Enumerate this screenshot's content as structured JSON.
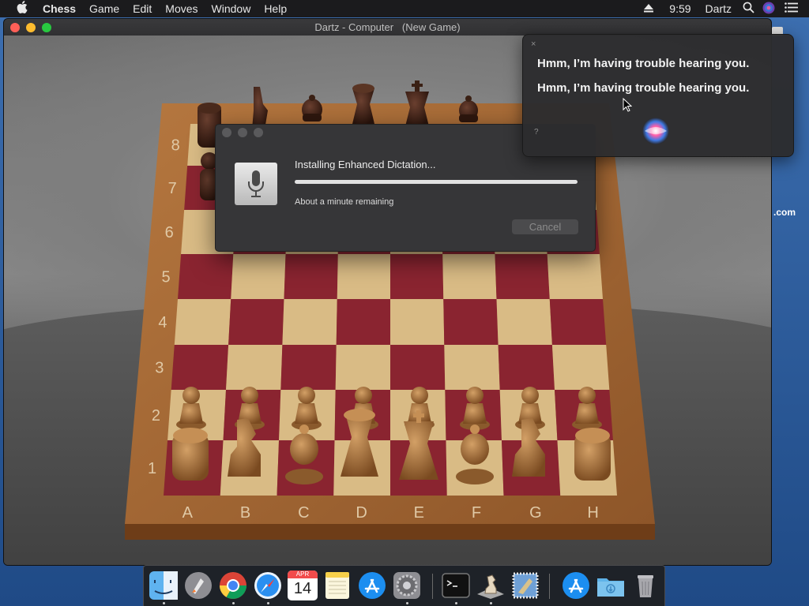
{
  "menubar": {
    "app_name": "Chess",
    "items": [
      "Game",
      "Edit",
      "Moves",
      "Window",
      "Help"
    ],
    "clock": "9:59",
    "user": "Dartz"
  },
  "window": {
    "title": "Dartz - Computer   (New Game)"
  },
  "board": {
    "ranks": [
      "8",
      "7",
      "6",
      "5",
      "4",
      "3",
      "2",
      "1"
    ],
    "files": [
      "A",
      "B",
      "C",
      "D",
      "E",
      "F",
      "G",
      "H"
    ]
  },
  "dialog": {
    "title": "Installing Enhanced Dictation...",
    "remaining": "About a minute remaining",
    "cancel_label": "Cancel",
    "progress": 1.0
  },
  "siri": {
    "close_label": "×",
    "lines": [
      "Hmm, I’m having trouble hearing you.",
      "Hmm, I’m having trouble hearing you."
    ],
    "help_label": "?"
  },
  "desktop": {
    "partial_text": ".com"
  },
  "dock": {
    "calendar_month": "APR",
    "calendar_day": "14"
  },
  "colors": {
    "menubar": "#1b1b1d",
    "light_square": "#d9bb85",
    "dark_square": "#8a2430",
    "board_frame": "#a86c3c"
  }
}
